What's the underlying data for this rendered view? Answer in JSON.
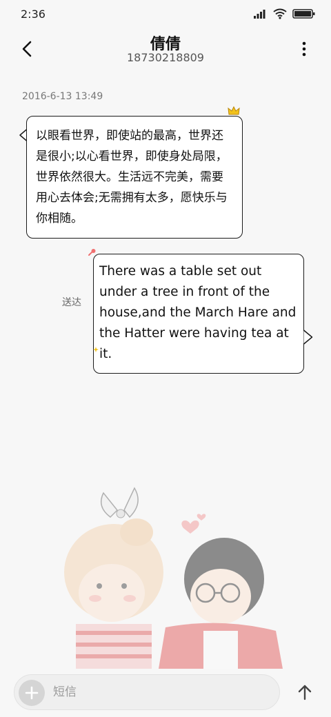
{
  "status_bar": {
    "time": "2:36",
    "icons": [
      "signal-icon",
      "wifi-icon",
      "battery-icon"
    ]
  },
  "header": {
    "contact_name": "倩倩",
    "phone_number": "18730218809",
    "back_icon": "back-arrow-icon",
    "more_icon": "more-vertical-icon"
  },
  "conversation": {
    "timestamp": "2016-6-13 13:49",
    "messages": [
      {
        "direction": "incoming",
        "text": "以眼看世界，即使站的最高，世界还是很小;以心看世界，即使身处局限，世界依然很大。生活远不完美，需要用心去体会;无需拥有太多，愿快乐与你相随。"
      },
      {
        "direction": "outgoing",
        "text": "There was a table set out under a tree in front of the house,and the March Hare and the Hatter were having tea at it.",
        "status": "送达"
      }
    ]
  },
  "compose": {
    "placeholder": "短信",
    "add_icon": "plus-icon",
    "send_icon": "send-arrow-icon"
  },
  "colors": {
    "background": "#f7f7f7",
    "bubble_border": "#1a1a1a",
    "crown_accent": "#f2c21b",
    "pin_accent": "#f07070"
  }
}
